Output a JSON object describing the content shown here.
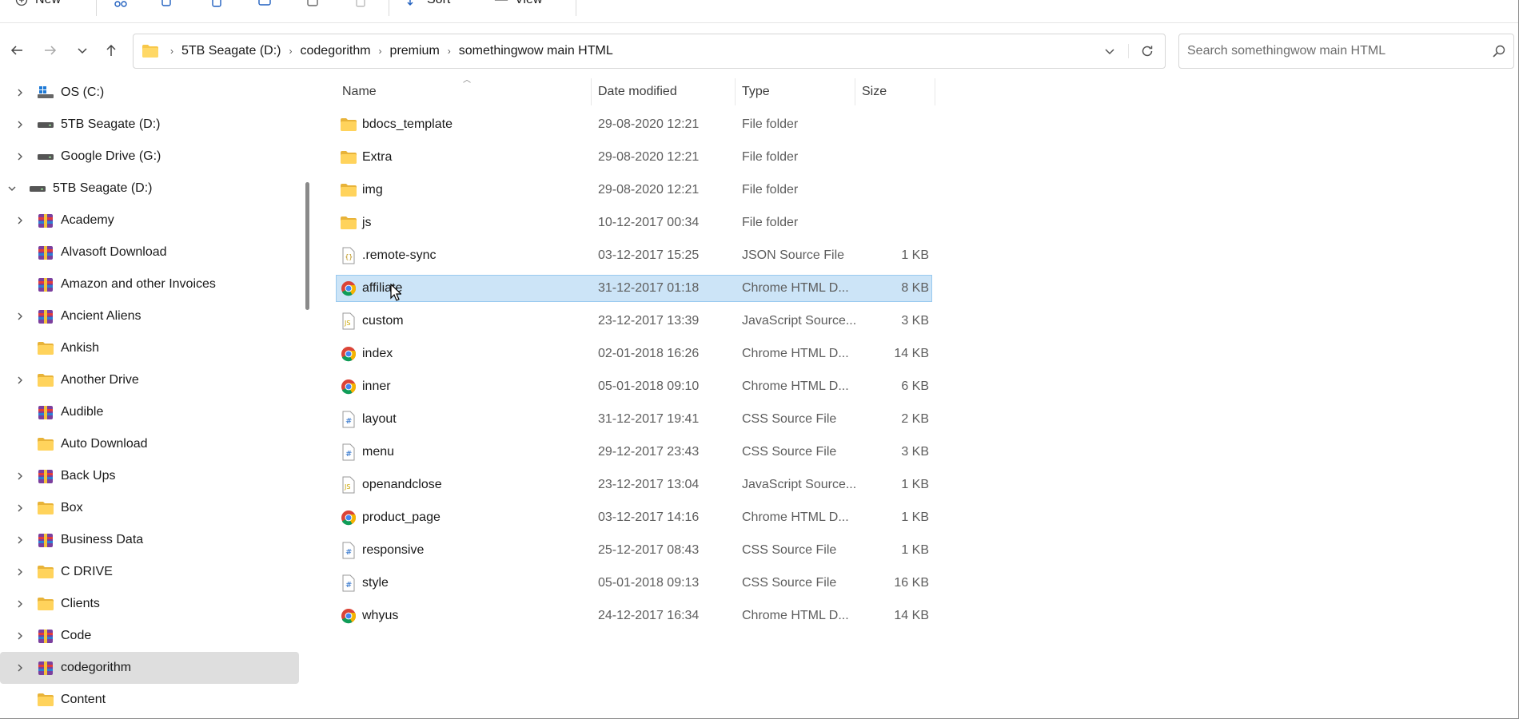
{
  "commandbar": {
    "new_label": "New",
    "sort_label": "Sort",
    "view_label": "View"
  },
  "address": {
    "crumbs": [
      "5TB Seagate (D:)",
      "codegorithm",
      "premium",
      "somethingwow main HTML"
    ]
  },
  "search": {
    "placeholder": "Search somethingwow main HTML"
  },
  "nav": {
    "items": [
      {
        "label": "OS (C:)",
        "icon": "windows-drive-icon",
        "expand": "collapsed",
        "indent": 0
      },
      {
        "label": "5TB Seagate (D:)",
        "icon": "drive-icon",
        "expand": "collapsed",
        "indent": 0
      },
      {
        "label": "Google Drive (G:)",
        "icon": "drive-icon",
        "expand": "collapsed",
        "indent": 0
      },
      {
        "label": "5TB Seagate (D:)",
        "icon": "drive-icon",
        "expand": "expanded",
        "indent": -1
      },
      {
        "label": "Academy",
        "icon": "winrar-icon",
        "expand": "collapsed",
        "indent": 0
      },
      {
        "label": "Alvasoft Download",
        "icon": "winrar-icon",
        "expand": "none",
        "indent": 0
      },
      {
        "label": "Amazon and other Invoices",
        "icon": "winrar-icon",
        "expand": "none",
        "indent": 0
      },
      {
        "label": "Ancient Aliens",
        "icon": "winrar-icon",
        "expand": "collapsed",
        "indent": 0
      },
      {
        "label": "Ankish",
        "icon": "folder-icon",
        "expand": "none",
        "indent": 0
      },
      {
        "label": "Another Drive",
        "icon": "folder-icon",
        "expand": "collapsed",
        "indent": 0
      },
      {
        "label": "Audible",
        "icon": "winrar-icon",
        "expand": "none",
        "indent": 0
      },
      {
        "label": "Auto Download",
        "icon": "folder-icon",
        "expand": "none",
        "indent": 0
      },
      {
        "label": "Back Ups",
        "icon": "winrar-icon",
        "expand": "collapsed",
        "indent": 0
      },
      {
        "label": "Box",
        "icon": "folder-icon",
        "expand": "collapsed",
        "indent": 0
      },
      {
        "label": "Business Data",
        "icon": "winrar-icon",
        "expand": "collapsed",
        "indent": 0
      },
      {
        "label": "C DRIVE",
        "icon": "folder-icon",
        "expand": "collapsed",
        "indent": 0
      },
      {
        "label": "Clients",
        "icon": "folder-icon",
        "expand": "collapsed",
        "indent": 0
      },
      {
        "label": "Code",
        "icon": "winrar-icon",
        "expand": "collapsed",
        "indent": 0
      },
      {
        "label": "codegorithm",
        "icon": "winrar-icon",
        "expand": "collapsed",
        "indent": 0,
        "selected": true
      },
      {
        "label": "Content",
        "icon": "folder-icon",
        "expand": "none",
        "indent": 0
      }
    ]
  },
  "columns": {
    "name": "Name",
    "date": "Date modified",
    "type": "Type",
    "size": "Size"
  },
  "files": [
    {
      "name": "bdocs_template",
      "date": "29-08-2020 12:21",
      "type": "File folder",
      "size": "",
      "icon": "folder-icon"
    },
    {
      "name": "Extra",
      "date": "29-08-2020 12:21",
      "type": "File folder",
      "size": "",
      "icon": "folder-icon"
    },
    {
      "name": "img",
      "date": "29-08-2020 12:21",
      "type": "File folder",
      "size": "",
      "icon": "folder-icon"
    },
    {
      "name": "js",
      "date": "10-12-2017 00:34",
      "type": "File folder",
      "size": "",
      "icon": "folder-icon"
    },
    {
      "name": ".remote-sync",
      "date": "03-12-2017 15:25",
      "type": "JSON Source File",
      "size": "1 KB",
      "icon": "json-file-icon"
    },
    {
      "name": "affiliate",
      "date": "31-12-2017 01:18",
      "type": "Chrome HTML D...",
      "size": "8 KB",
      "icon": "chrome-icon",
      "selected": true
    },
    {
      "name": "custom",
      "date": "23-12-2017 13:39",
      "type": "JavaScript Source...",
      "size": "3 KB",
      "icon": "js-file-icon"
    },
    {
      "name": "index",
      "date": "02-01-2018 16:26",
      "type": "Chrome HTML D...",
      "size": "14 KB",
      "icon": "chrome-icon"
    },
    {
      "name": "inner",
      "date": "05-01-2018 09:10",
      "type": "Chrome HTML D...",
      "size": "6 KB",
      "icon": "chrome-icon"
    },
    {
      "name": "layout",
      "date": "31-12-2017 19:41",
      "type": "CSS Source File",
      "size": "2 KB",
      "icon": "css-file-icon"
    },
    {
      "name": "menu",
      "date": "29-12-2017 23:43",
      "type": "CSS Source File",
      "size": "3 KB",
      "icon": "css-file-icon"
    },
    {
      "name": "openandclose",
      "date": "23-12-2017 13:04",
      "type": "JavaScript Source...",
      "size": "1 KB",
      "icon": "js-file-icon"
    },
    {
      "name": "product_page",
      "date": "03-12-2017 14:16",
      "type": "Chrome HTML D...",
      "size": "1 KB",
      "icon": "chrome-icon"
    },
    {
      "name": "responsive",
      "date": "25-12-2017 08:43",
      "type": "CSS Source File",
      "size": "1 KB",
      "icon": "css-file-icon"
    },
    {
      "name": "style",
      "date": "05-01-2018 09:13",
      "type": "CSS Source File",
      "size": "16 KB",
      "icon": "css-file-icon"
    },
    {
      "name": "whyus",
      "date": "24-12-2017 16:34",
      "type": "Chrome HTML D...",
      "size": "14 KB",
      "icon": "chrome-icon"
    }
  ],
  "colors": {
    "selection_bg": "#cce4f7",
    "selection_border": "#99c9ef",
    "nav_selected_bg": "#dedede",
    "folder": "#f8c84a",
    "accent": "#1f5fbf"
  }
}
